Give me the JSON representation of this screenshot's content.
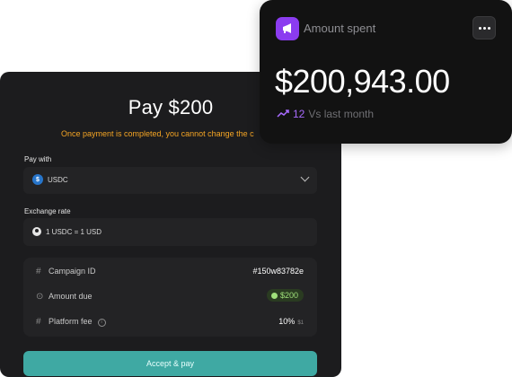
{
  "payment": {
    "title": "Pay $200",
    "warning": "Once payment is completed, you cannot change the c",
    "pay_with_label": "Pay with",
    "pay_with_value": "USDC",
    "exchange_rate_label": "Exchange rate",
    "exchange_rate_value": "1 USDC = 1 USD",
    "details": {
      "campaign_id_label": "Campaign  ID",
      "campaign_id_value": "#150w83782e",
      "amount_due_label": "Amount due",
      "amount_due_value": "$200",
      "platform_fee_label": "Platform fee",
      "platform_fee_value": "10%",
      "platform_fee_sub": "$1"
    },
    "accept_button": "Accept & pay"
  },
  "spent": {
    "label": "Amount spent",
    "amount": "$200,943.00",
    "trend_value": "12",
    "trend_text": "Vs last month"
  },
  "colors": {
    "accent_teal": "#3fa9a3",
    "warning_orange": "#f5a524",
    "purple": "#8b3cf0",
    "success_green": "#9fe07a"
  }
}
